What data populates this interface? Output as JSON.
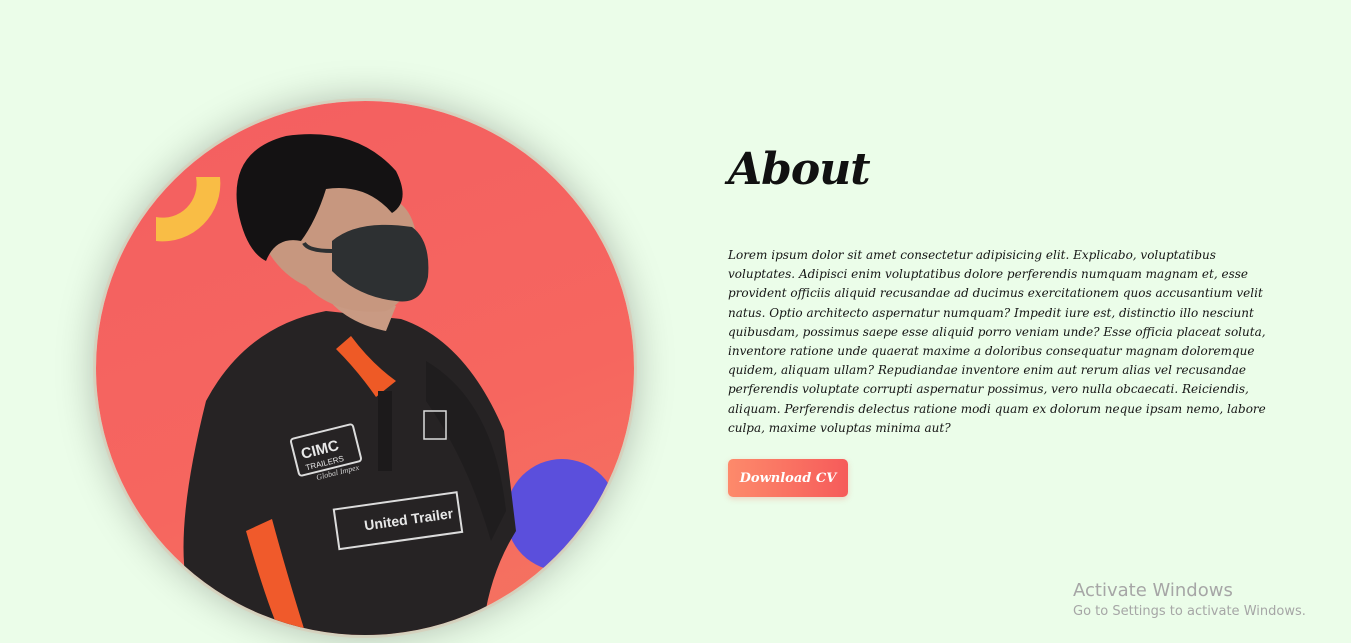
{
  "about": {
    "title": "About",
    "paragraph": "Lorem ipsum dolor sit amet consectetur adipisicing elit. Explicabo, voluptatibus voluptates. Adipisci enim voluptatibus dolore perferendis numquam magnam et, esse provident officiis aliquid recusandae ad ducimus exercitationem quos accusantium velit natus. Optio architecto aspernatur numquam? Impedit iure est, distinctio illo nesciunt quibusdam, possimus saepe esse aliquid porro veniam unde? Esse officia placeat soluta, inventore ratione unde quaerat maxime a doloribus consequatur magnam doloremque quidem, aliquam ullam? Repudiandae inventore enim aut rerum alias vel recusandae perferendis voluptate corrupti aspernatur possimus, vero nulla obcaecati. Reiciendis, aliquam. Perferendis delectus ratione modi quam ex dolorum neque ipsam nemo, labore culpa, maxime voluptas minima aut?",
    "button_label": "Download CV"
  },
  "portrait": {
    "shirt_brand_left_line1": "CIMC",
    "shirt_brand_left_line2": "TRAILERS",
    "shirt_brand_left_line3": "Global Impex",
    "shirt_brand_bottom": "United Trailer"
  },
  "watermark": {
    "title": "Activate Windows",
    "subtitle": "Go to Settings to activate Windows."
  },
  "colors": {
    "background": "#ebfde9",
    "circle_red": "#f35f61",
    "accent_yellow": "#f9bd45",
    "accent_blue": "#5b4fdc",
    "button_start": "#fd8a6b",
    "button_end": "#f65b5a"
  }
}
